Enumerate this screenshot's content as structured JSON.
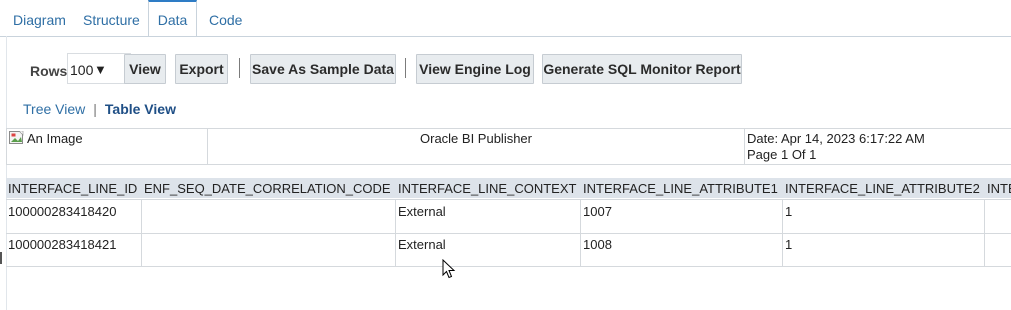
{
  "tabs": [
    {
      "label": "Diagram"
    },
    {
      "label": "Structure"
    },
    {
      "label": "Data"
    },
    {
      "label": "Code"
    }
  ],
  "toolbar": {
    "rows_label": "Rows",
    "rows_value": "100",
    "view_label": "View",
    "export_label": "Export",
    "save_sample_label": "Save As Sample Data",
    "engine_log_label": "View Engine Log",
    "sql_monitor_label": "Generate SQL Monitor Report"
  },
  "view_links": {
    "tree": "Tree View",
    "separator": "|",
    "table": "Table View"
  },
  "report_header": {
    "image_alt": "An Image",
    "publisher": "Oracle BI Publisher",
    "date": "Date: Apr 14, 2023 6:17:22 AM",
    "page": "Page 1 Of 1"
  },
  "table": {
    "columns": [
      "INTERFACE_LINE_ID",
      "ENF_SEQ_DATE_CORRELATION_CODE",
      "INTERFACE_LINE_CONTEXT",
      "INTERFACE_LINE_ATTRIBUTE1",
      "INTERFACE_LINE_ATTRIBUTE2",
      "INTE"
    ],
    "rows": [
      [
        "100000283418420",
        "",
        "External",
        "1007",
        "1",
        ""
      ],
      [
        "100000283418421",
        "",
        "External",
        "1008",
        "1",
        ""
      ]
    ]
  },
  "icons": {
    "rows_dropdown": "caret-down-icon",
    "broken_image": "broken-image-icon",
    "cursor": "mouse-pointer-icon"
  },
  "colors": {
    "tab_active_border": "#2e7cc5",
    "link": "#2f6fa5",
    "table_header_bg": "#dde3ea",
    "button_bg": "#e8ecef"
  }
}
